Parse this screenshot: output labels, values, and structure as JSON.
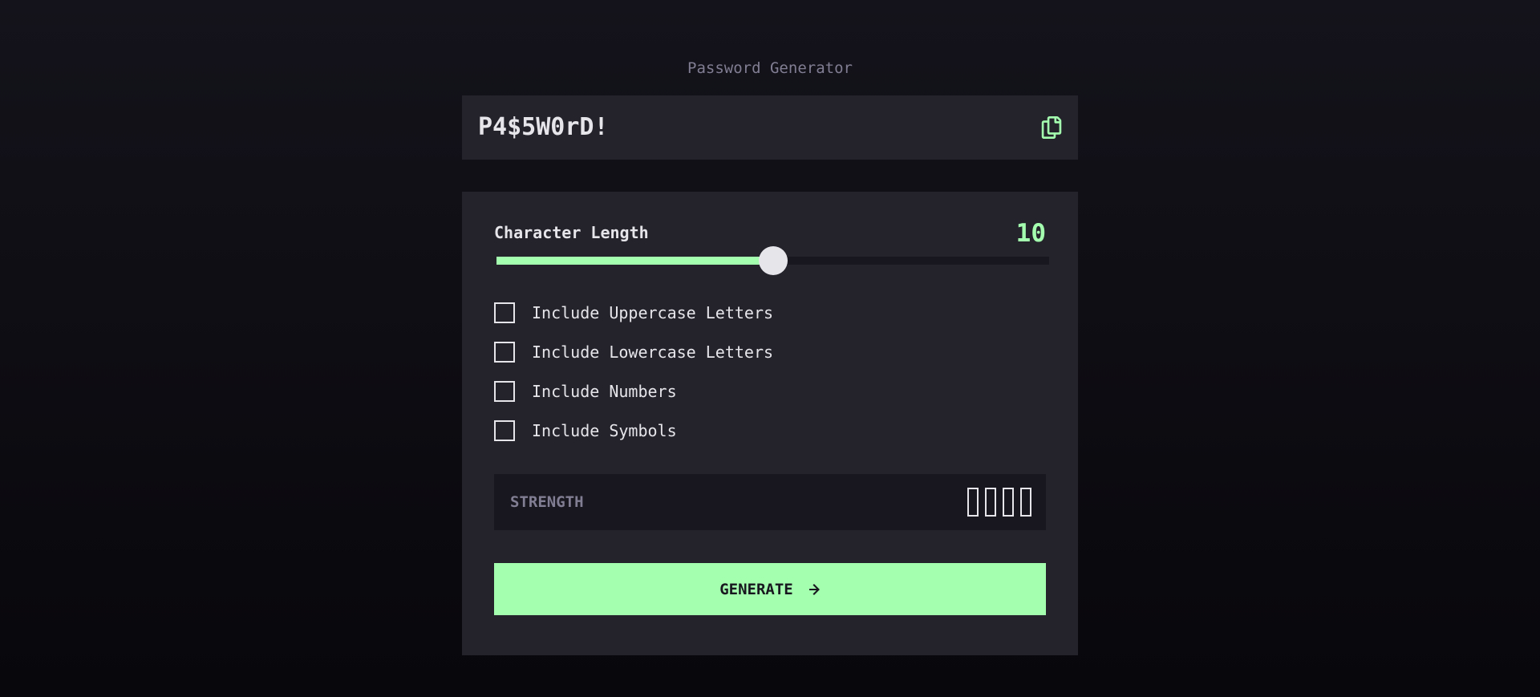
{
  "app": {
    "title": "Password Generator"
  },
  "output": {
    "password": "P4$5W0rD!",
    "copy_icon": "copy-icon"
  },
  "length": {
    "label": "Character Length",
    "value": "10",
    "min": 0,
    "max": 20,
    "current": 10
  },
  "options": [
    {
      "label": "Include Uppercase Letters",
      "checked": false
    },
    {
      "label": "Include Lowercase Letters",
      "checked": false
    },
    {
      "label": "Include Numbers",
      "checked": false
    },
    {
      "label": "Include Symbols",
      "checked": false
    }
  ],
  "strength": {
    "label": "STRENGTH",
    "level": 0,
    "bars": 4
  },
  "generate": {
    "label": "GENERATE",
    "icon": "arrow-right-icon"
  },
  "colors": {
    "accent": "#a4ffaf",
    "panel": "#24232c",
    "dark": "#18171f",
    "muted": "#817d92",
    "text": "#e6e5ea"
  }
}
